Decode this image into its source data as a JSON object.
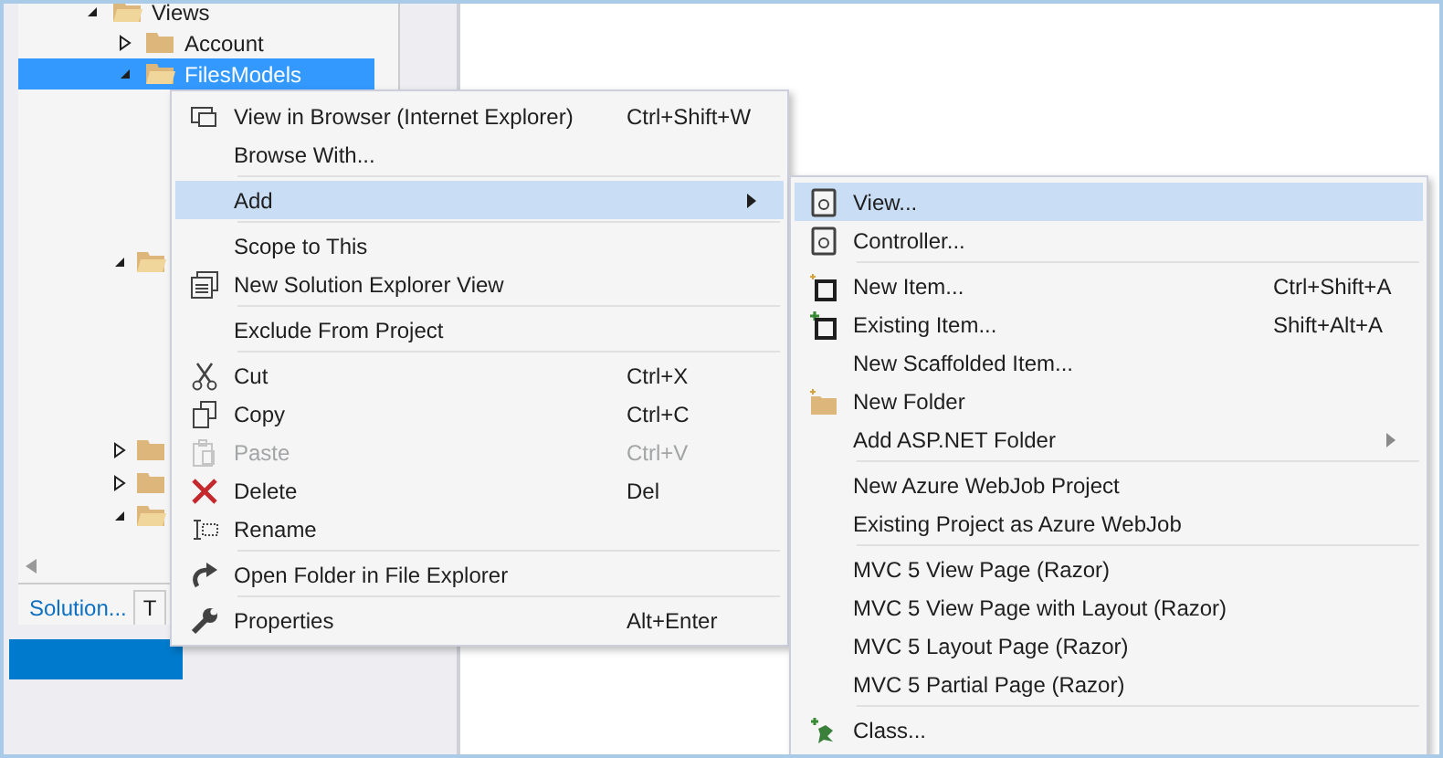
{
  "tree": {
    "items": [
      {
        "label": "Views",
        "expanded": true,
        "selected": false,
        "children": [
          {
            "label": "Account",
            "expanded": false,
            "selected": false
          },
          {
            "label": "FilesModels",
            "expanded": true,
            "selected": true
          }
        ]
      }
    ],
    "hidden_rows": [
      {
        "expanded": true
      },
      {
        "expanded": false
      },
      {
        "expanded": false
      },
      {
        "expanded": true
      }
    ]
  },
  "bottom_tabs": [
    {
      "label": "Solution...",
      "selected": true
    },
    {
      "label": "T",
      "selected": false
    }
  ],
  "context_menu": {
    "items": [
      {
        "kind": "item",
        "label": "View in Browser (Internet Explorer)",
        "shortcut": "Ctrl+Shift+W",
        "selected": false,
        "disabled": false
      },
      {
        "kind": "item",
        "label": "Browse With...",
        "selected": false,
        "disabled": false
      },
      {
        "kind": "separator"
      },
      {
        "kind": "item",
        "label": "Add",
        "submenu": true,
        "selected": true,
        "disabled": false
      },
      {
        "kind": "separator"
      },
      {
        "kind": "item",
        "label": "Scope to This",
        "selected": false,
        "disabled": false
      },
      {
        "kind": "item",
        "label": "New Solution Explorer View",
        "selected": false,
        "disabled": false
      },
      {
        "kind": "separator"
      },
      {
        "kind": "item",
        "label": "Exclude From Project",
        "selected": false,
        "disabled": false
      },
      {
        "kind": "separator"
      },
      {
        "kind": "item",
        "label": "Cut",
        "shortcut": "Ctrl+X",
        "selected": false,
        "disabled": false
      },
      {
        "kind": "item",
        "label": "Copy",
        "shortcut": "Ctrl+C",
        "selected": false,
        "disabled": false
      },
      {
        "kind": "item",
        "label": "Paste",
        "shortcut": "Ctrl+V",
        "selected": false,
        "disabled": true
      },
      {
        "kind": "item",
        "label": "Delete",
        "shortcut": "Del",
        "selected": false,
        "disabled": false
      },
      {
        "kind": "item",
        "label": "Rename",
        "selected": false,
        "disabled": false
      },
      {
        "kind": "separator"
      },
      {
        "kind": "item",
        "label": "Open Folder in File Explorer",
        "selected": false,
        "disabled": false
      },
      {
        "kind": "separator"
      },
      {
        "kind": "item",
        "label": "Properties",
        "shortcut": "Alt+Enter",
        "selected": false,
        "disabled": false
      }
    ]
  },
  "submenu": {
    "items": [
      {
        "kind": "item",
        "label": "View...",
        "selected": true,
        "disabled": false
      },
      {
        "kind": "item",
        "label": "Controller...",
        "selected": false,
        "disabled": false
      },
      {
        "kind": "separator"
      },
      {
        "kind": "item",
        "label": "New Item...",
        "shortcut": "Ctrl+Shift+A",
        "selected": false,
        "disabled": false
      },
      {
        "kind": "item",
        "label": "Existing Item...",
        "shortcut": "Shift+Alt+A",
        "selected": false,
        "disabled": false
      },
      {
        "kind": "item",
        "label": "New Scaffolded Item...",
        "selected": false,
        "disabled": false
      },
      {
        "kind": "item",
        "label": "New Folder",
        "selected": false,
        "disabled": false
      },
      {
        "kind": "item",
        "label": "Add ASP.NET Folder",
        "submenu": true,
        "selected": false,
        "disabled": false
      },
      {
        "kind": "separator"
      },
      {
        "kind": "item",
        "label": "New Azure WebJob Project",
        "selected": false,
        "disabled": false
      },
      {
        "kind": "item",
        "label": "Existing Project as Azure WebJob",
        "selected": false,
        "disabled": false
      },
      {
        "kind": "separator"
      },
      {
        "kind": "item",
        "label": "MVC 5 View Page (Razor)",
        "selected": false,
        "disabled": false
      },
      {
        "kind": "item",
        "label": "MVC 5 View Page with Layout (Razor)",
        "selected": false,
        "disabled": false
      },
      {
        "kind": "item",
        "label": "MVC 5 Layout Page (Razor)",
        "selected": false,
        "disabled": false
      },
      {
        "kind": "item",
        "label": "MVC 5 Partial Page (Razor)",
        "selected": false,
        "disabled": false
      },
      {
        "kind": "separator"
      },
      {
        "kind": "item",
        "label": "Class...",
        "selected": false,
        "disabled": false
      }
    ]
  }
}
